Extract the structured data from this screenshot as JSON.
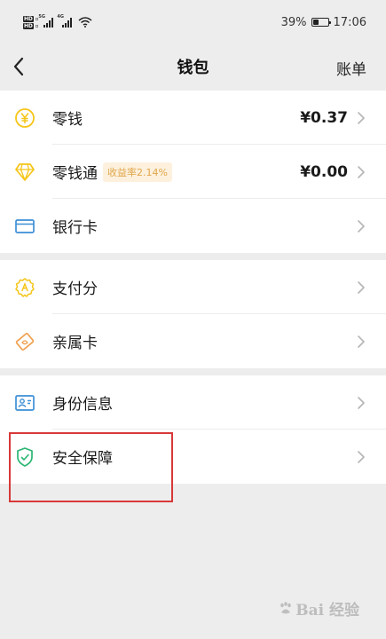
{
  "status_bar": {
    "sim_labels": [
      "HD",
      "HD"
    ],
    "network_labels": [
      "5G",
      "4G"
    ],
    "battery_percent": "39%",
    "battery_level": 0.39,
    "time": "17:06"
  },
  "nav": {
    "back_icon": "chevron-left-icon",
    "title": "钱包",
    "bill_label": "账单"
  },
  "groups": [
    {
      "items": [
        {
          "label": "零钱",
          "value": "¥0.37",
          "icon": "yuan-coin-icon"
        },
        {
          "label": "零钱通",
          "badge": "收益率2.14%",
          "value": "¥0.00",
          "icon": "diamond-icon"
        },
        {
          "label": "银行卡",
          "icon": "bank-card-icon"
        }
      ]
    },
    {
      "items": [
        {
          "label": "支付分",
          "icon": "pay-score-icon"
        },
        {
          "label": "亲属卡",
          "icon": "family-card-icon"
        }
      ]
    },
    {
      "items": [
        {
          "label": "身份信息",
          "icon": "id-card-icon"
        },
        {
          "label": "安全保障",
          "icon": "shield-icon"
        }
      ]
    }
  ],
  "colors": {
    "accent_yellow": "#f5c518",
    "accent_orange": "#f0a050",
    "accent_blue": "#3d8fd6",
    "accent_green": "#2bb673",
    "highlight_red": "#d83838"
  },
  "watermark": "Bai 经验"
}
